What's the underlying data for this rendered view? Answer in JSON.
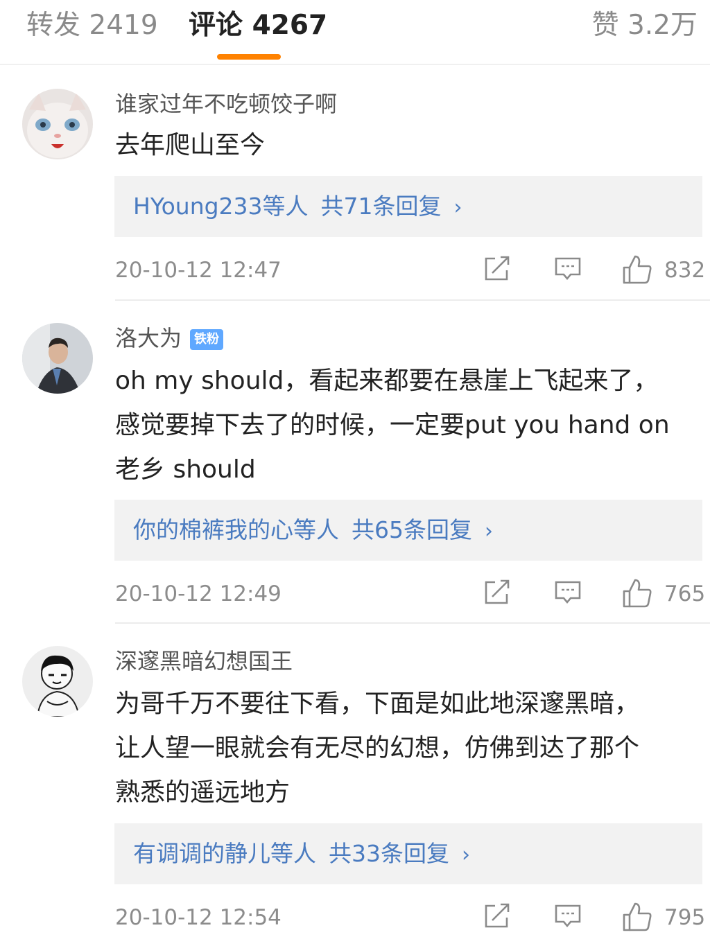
{
  "tabs": {
    "repost": "转发 2419",
    "comments": "评论 4267",
    "likes": "赞 3.2万"
  },
  "accent_color": "#ff8200",
  "link_color": "#4a7bc0",
  "comments": [
    {
      "username": "谁家过年不吃顿饺子啊",
      "text_lines": [
        "去年爬山至今"
      ],
      "reply_users": "HYoung233",
      "reply_suffix": "等人",
      "reply_count": "共71条回复",
      "chevron": "›",
      "time": "20-10-12 12:47",
      "likes": "832",
      "avatar_icon": "cat-avatar"
    },
    {
      "username": "洛大为",
      "badge": "铁粉",
      "text_lines": [
        "oh my should，看起来都要在悬崖上飞起来了，",
        "感觉要掉下去了的时候，一定要put you hand on",
        "老乡 should"
      ],
      "reply_users": "你的棉裤我的心",
      "reply_suffix": "等人",
      "reply_count": "共65条回复",
      "chevron": "›",
      "time": "20-10-12 12:49",
      "likes": "765",
      "avatar_icon": "man-avatar"
    },
    {
      "username": "深邃黑暗幻想国王",
      "text_lines": [
        "为哥千万不要往下看，下面是如此地深邃黑暗，",
        "让人望一眼就会有无尽的幻想，仿佛到达了那个",
        "熟悉的遥远地方"
      ],
      "reply_users": "有调调的静儿",
      "reply_suffix": "等人",
      "reply_count": "共33条回复",
      "chevron": "›",
      "time": "20-10-12 12:54",
      "likes": "795",
      "avatar_icon": "sketch-avatar"
    }
  ]
}
